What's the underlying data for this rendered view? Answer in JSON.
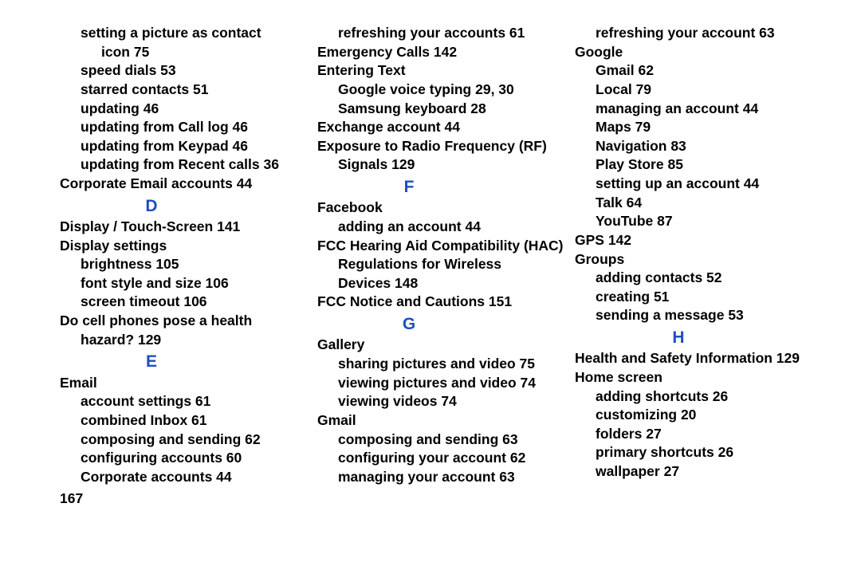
{
  "page_number": "167",
  "columns": {
    "c1": [
      {
        "lvl": 2,
        "t": "setting a picture as contact"
      },
      {
        "lvl": 3,
        "t": "icon 75"
      },
      {
        "lvl": 2,
        "t": "speed dials 53"
      },
      {
        "lvl": 2,
        "t": "starred contacts 51"
      },
      {
        "lvl": 2,
        "t": "updating 46"
      },
      {
        "lvl": 2,
        "t": "updating from Call log 46"
      },
      {
        "lvl": 2,
        "t": "updating from Keypad 46"
      },
      {
        "lvl": 2,
        "t": "updating from Recent calls 36"
      },
      {
        "lvl": 1,
        "t": "Corporate Email accounts 44"
      },
      {
        "letter": "D"
      },
      {
        "lvl": 1,
        "t": "Display / Touch-Screen 141"
      },
      {
        "lvl": 1,
        "t": "Display settings"
      },
      {
        "lvl": 2,
        "t": "brightness 105"
      },
      {
        "lvl": 2,
        "t": "font style and size 106"
      },
      {
        "lvl": 2,
        "t": "screen timeout 106"
      },
      {
        "lvl": 1,
        "t": "Do cell phones pose a health"
      },
      {
        "lvl": 2,
        "t": "hazard? 129"
      },
      {
        "letter": "E"
      },
      {
        "lvl": 1,
        "t": "Email"
      },
      {
        "lvl": 2,
        "t": "account settings 61"
      },
      {
        "lvl": 2,
        "t": "combined Inbox 61"
      },
      {
        "lvl": 2,
        "t": "composing and sending 62"
      },
      {
        "lvl": 2,
        "t": "configuring accounts 60"
      },
      {
        "lvl": 2,
        "t": "Corporate accounts 44"
      }
    ],
    "c2": [
      {
        "lvl": 2,
        "t": "refreshing your accounts 61"
      },
      {
        "lvl": 1,
        "t": "Emergency Calls 142"
      },
      {
        "lvl": 1,
        "t": "Entering Text"
      },
      {
        "lvl": 2,
        "t": "Google voice typing 29, 30"
      },
      {
        "lvl": 2,
        "t": "Samsung keyboard 28"
      },
      {
        "lvl": 1,
        "t": "Exchange account 44"
      },
      {
        "lvl": 1,
        "t": "Exposure to Radio Frequency (RF)"
      },
      {
        "lvl": 2,
        "t": "Signals 129"
      },
      {
        "letter": "F"
      },
      {
        "lvl": 1,
        "t": "Facebook"
      },
      {
        "lvl": 2,
        "t": "adding an account 44"
      },
      {
        "lvl": 1,
        "t": "FCC Hearing Aid Compatibility (HAC)"
      },
      {
        "lvl": 2,
        "t": "Regulations for Wireless"
      },
      {
        "lvl": 2,
        "t": "Devices 148"
      },
      {
        "lvl": 1,
        "t": "FCC Notice and Cautions 151"
      },
      {
        "letter": "G"
      },
      {
        "lvl": 1,
        "t": "Gallery"
      },
      {
        "lvl": 2,
        "t": "sharing pictures and video 75"
      },
      {
        "lvl": 2,
        "t": "viewing pictures and video 74"
      },
      {
        "lvl": 2,
        "t": "viewing videos 74"
      },
      {
        "lvl": 1,
        "t": "Gmail"
      },
      {
        "lvl": 2,
        "t": "composing and sending 63"
      },
      {
        "lvl": 2,
        "t": "configuring your account 62"
      },
      {
        "lvl": 2,
        "t": "managing your account 63"
      }
    ],
    "c3": [
      {
        "lvl": 2,
        "t": "refreshing your account 63"
      },
      {
        "lvl": 1,
        "t": "Google"
      },
      {
        "lvl": 2,
        "t": "Gmail 62"
      },
      {
        "lvl": 2,
        "t": "Local 79"
      },
      {
        "lvl": 2,
        "t": "managing an account 44"
      },
      {
        "lvl": 2,
        "t": "Maps 79"
      },
      {
        "lvl": 2,
        "t": "Navigation 83"
      },
      {
        "lvl": 2,
        "t": "Play Store 85"
      },
      {
        "lvl": 2,
        "t": "setting up an account 44"
      },
      {
        "lvl": 2,
        "t": "Talk 64"
      },
      {
        "lvl": 2,
        "t": "YouTube 87"
      },
      {
        "lvl": 1,
        "t": "GPS 142"
      },
      {
        "lvl": 1,
        "t": "Groups"
      },
      {
        "lvl": 2,
        "t": "adding contacts 52"
      },
      {
        "lvl": 2,
        "t": "creating 51"
      },
      {
        "lvl": 2,
        "t": "sending a message 53"
      },
      {
        "letter": "H"
      },
      {
        "lvl": 1,
        "t": "Health and Safety Information 129"
      },
      {
        "lvl": 1,
        "t": "Home screen"
      },
      {
        "lvl": 2,
        "t": "adding shortcuts 26"
      },
      {
        "lvl": 2,
        "t": "customizing 20"
      },
      {
        "lvl": 2,
        "t": "folders 27"
      },
      {
        "lvl": 2,
        "t": "primary shortcuts 26"
      },
      {
        "lvl": 2,
        "t": "wallpaper 27"
      }
    ]
  }
}
